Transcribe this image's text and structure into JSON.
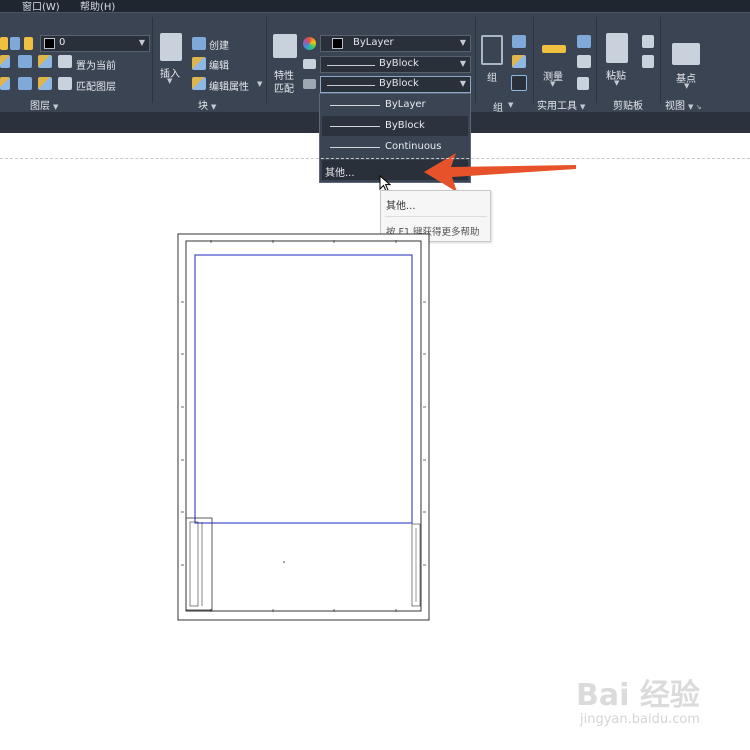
{
  "menu": {
    "items": [
      "窗口(W)",
      "帮助(H)"
    ]
  },
  "layer_panel": {
    "layer_name": "0",
    "set_current": "置为当前",
    "match_layer": "匹配图层",
    "title": "图层"
  },
  "block_panel": {
    "insert": "插入",
    "create": "创建",
    "edit": "编辑",
    "edit_attributes": "编辑属性",
    "title": "块"
  },
  "properties_panel": {
    "match_properties_line1": "特性",
    "match_properties_line2": "匹配",
    "color_value": "ByLayer",
    "lineweight_value": "ByBlock",
    "linetype_value": "ByBlock"
  },
  "linetype_dropdown": {
    "options": [
      "ByLayer",
      "ByBlock",
      "Continuous"
    ],
    "other": "其他..."
  },
  "group_panel": {
    "group": "组",
    "title": "组"
  },
  "utilities_panel": {
    "measure": "测量",
    "title": "实用工具"
  },
  "clipboard_panel": {
    "paste": "粘贴",
    "title": "剪贴板"
  },
  "view_panel": {
    "base": "基点",
    "title": "视图"
  },
  "tooltip": {
    "title": "其他...",
    "help": "按 F1 键获得更多帮助"
  },
  "watermark": {
    "main": "Bai 经验",
    "sub": "jingyan.baidu.com"
  },
  "colors": {
    "ribbon_bg": "#3b4453",
    "menubar_bg": "#1f2630",
    "arrow": "#e8522a",
    "viewport_frame": "#3f4bcc"
  }
}
